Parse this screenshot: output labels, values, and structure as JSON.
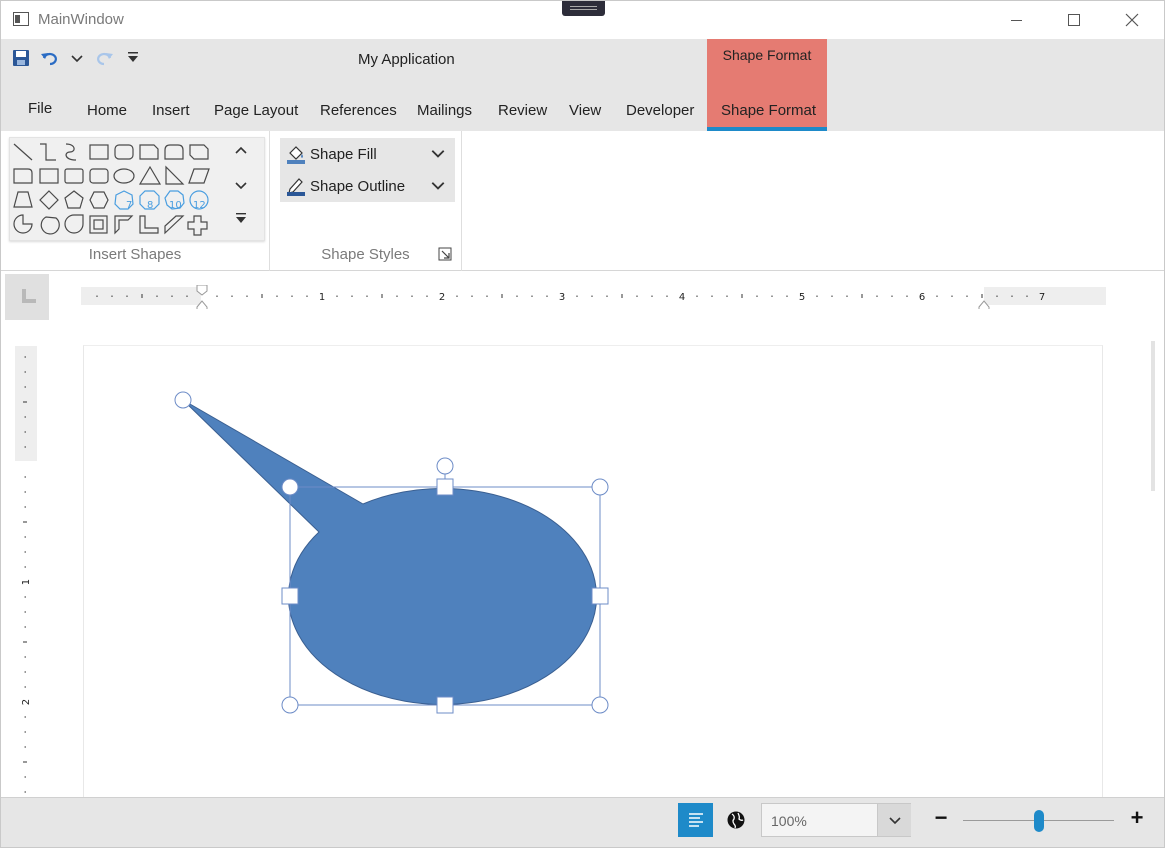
{
  "window": {
    "title": "MainWindow"
  },
  "ribbon": {
    "app_title": "My Application",
    "contextual_tab": {
      "group_label": "Shape Format",
      "tab_label": "Shape Format",
      "color": "#e57b72"
    },
    "tabs": [
      "File",
      "Home",
      "Insert",
      "Page Layout",
      "References",
      "Mailings",
      "Review",
      "View",
      "Developer"
    ],
    "active_tab": "Shape Format",
    "accent_color": "#1e8ac9",
    "quick_access": [
      "save-icon",
      "undo-icon",
      "undo-dropdown-icon",
      "redo-icon",
      "customize-qat-icon"
    ],
    "groups": {
      "insert_shapes": {
        "label": "Insert Shapes",
        "shape_numbers": [
          "7",
          "8",
          "10",
          "12"
        ]
      },
      "shape_styles": {
        "label": "Shape Styles",
        "fill_label": "Shape Fill",
        "outline_label": "Shape Outline"
      }
    }
  },
  "rulers": {
    "horizontal_numbers": [
      "1",
      "2",
      "3",
      "4",
      "5",
      "6",
      "7"
    ],
    "vertical_numbers": [
      "1",
      "2"
    ]
  },
  "document": {
    "shape": {
      "type": "oval callout",
      "fill_color": "#4f81bd",
      "selected": true
    }
  },
  "status_bar": {
    "zoom_value": "100%",
    "zoom_minus": "−",
    "zoom_plus": "+",
    "zoom_slider_percent": 100
  }
}
